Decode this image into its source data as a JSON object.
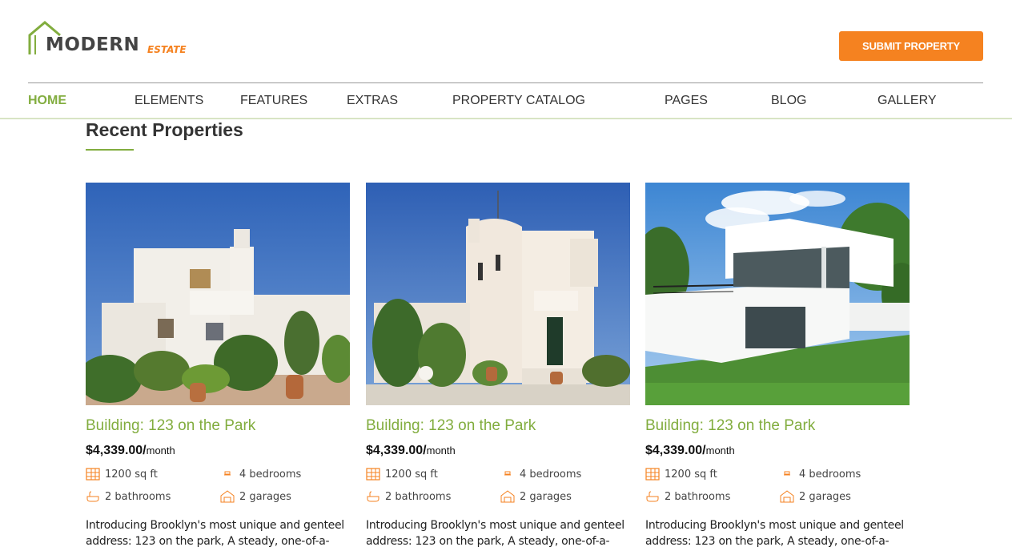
{
  "brand": {
    "main": "MODERN",
    "sub": "ESTATE"
  },
  "header": {
    "submit_label": "SUBMIT PROPERTY"
  },
  "nav": [
    {
      "label": "HOME",
      "active": true
    },
    {
      "label": "ELEMENTS"
    },
    {
      "label": "FEATURES"
    },
    {
      "label": "EXTRAS"
    },
    {
      "label": "PROPERTY CATALOG"
    },
    {
      "label": "PAGES"
    },
    {
      "label": "BLOG"
    },
    {
      "label": "GALLERY"
    }
  ],
  "section": {
    "title": "Recent Properties"
  },
  "properties": [
    {
      "title": "Building: 123 on the Park",
      "price": "$4,339.00/",
      "price_unit": "month",
      "area": "1200 sq ft",
      "bedrooms": "4 bedrooms",
      "bathrooms": "2 bathrooms",
      "garages": "2 garages",
      "description": "Introducing Brooklyn's most unique and genteel address: 123 on the park, A steady, one-of-a-"
    },
    {
      "title": "Building: 123 on the Park",
      "price": "$4,339.00/",
      "price_unit": "month",
      "area": "1200 sq ft",
      "bedrooms": "4 bedrooms",
      "bathrooms": "2 bathrooms",
      "garages": "2 garages",
      "description": "Introducing Brooklyn's most unique and genteel address: 123 on the park, A steady, one-of-a-"
    },
    {
      "title": "Building: 123 on the Park",
      "price": "$4,339.00/",
      "price_unit": "month",
      "area": "1200 sq ft",
      "bedrooms": "4 bedrooms",
      "bathrooms": "2 bathrooms",
      "garages": "2 garages",
      "description": "Introducing Brooklyn's most unique and genteel address: 123 on the park, A steady, one-of-a-"
    }
  ],
  "icons": {
    "logo": "house-roof-icon",
    "area": "floor-plan-icon",
    "bedrooms": "bed-icon",
    "bathrooms": "bathtub-icon",
    "garages": "garage-icon"
  },
  "colors": {
    "accent": "#82ad3f",
    "brand_orange": "#f58220",
    "nav_text": "#333333"
  }
}
